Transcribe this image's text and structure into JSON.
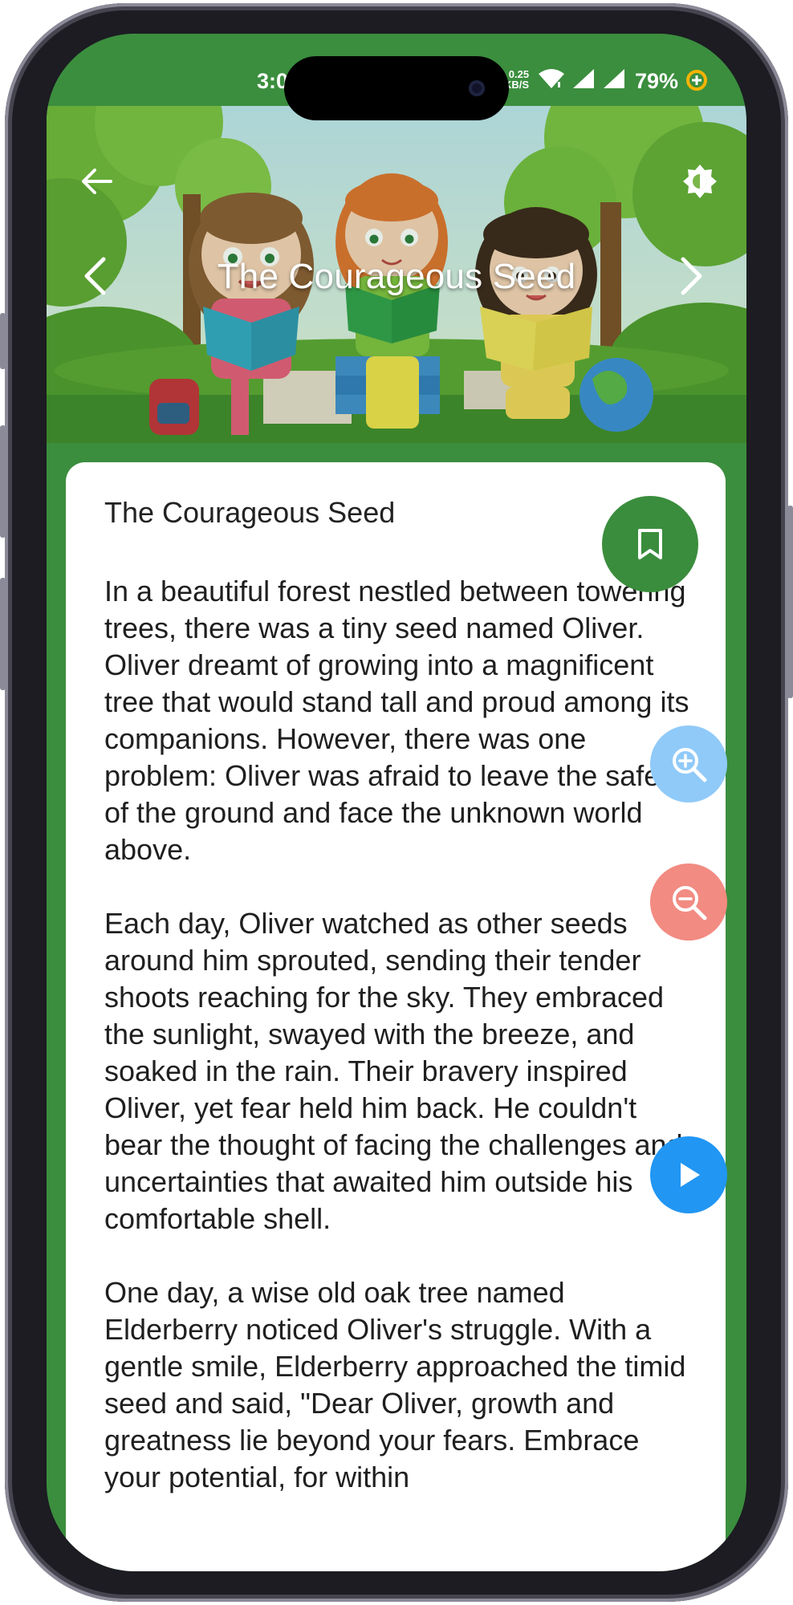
{
  "status_bar": {
    "time": "3:0",
    "net_speed_value": "0.25",
    "net_speed_unit": "KB/S",
    "battery_percent": "79%",
    "icons": [
      "wifi-icon",
      "signal-icon",
      "signal-icon",
      "battery-saver-icon"
    ]
  },
  "header": {
    "title": "The Courageous Seed",
    "back_icon": "arrow-left-icon",
    "theme_icon": "brightness-icon",
    "prev_icon": "chevron-left-icon",
    "next_icon": "chevron-right-icon"
  },
  "story": {
    "title": "The Courageous Seed",
    "body": "In a beautiful forest nestled between towering trees, there was a tiny seed named Oliver. Oliver dreamt of growing into a magnificent tree that would stand tall and proud among its companions. However, there was one problem: Oliver was afraid to leave the safety of the ground and face the unknown world above.\n\nEach day, Oliver watched as other seeds around him sprouted, sending their tender shoots reaching for the sky. They embraced the sunlight, swayed with the breeze, and soaked in the rain. Their bravery inspired Oliver, yet fear held him back. He couldn't bear the thought of facing the challenges and uncertainties that awaited him outside his comfortable shell.\n\nOne day, a wise old oak tree named Elderberry noticed Oliver's struggle. With a gentle smile, Elderberry approached the timid seed and said, \"Dear Oliver, growth and greatness lie beyond your fears. Embrace your potential, for within"
  },
  "actions": {
    "bookmark_icon": "bookmark-icon",
    "zoom_in_icon": "zoom-in-icon",
    "zoom_out_icon": "zoom-out-icon",
    "play_icon": "play-icon"
  },
  "colors": {
    "primary_green": "#3b8e3e",
    "bookmark_green": "#3a8d3d",
    "zoom_in_blue": "#90caf9",
    "zoom_out_red": "#f28b82",
    "play_blue": "#2196f3"
  }
}
